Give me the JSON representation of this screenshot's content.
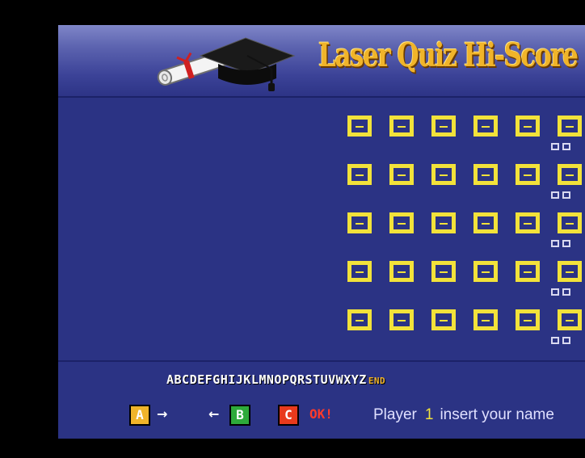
{
  "header": {
    "title": "Laser Quiz Hi-Score"
  },
  "name_grid": {
    "rows": 5,
    "visible_slots_per_row": 6,
    "slot_color": "#f2e23a",
    "background_color": "#2b3384"
  },
  "alphabet": {
    "letters": "ABCDEFGHIJKLMNOPQRSTUVWXYZ",
    "end_label": "END"
  },
  "controls": {
    "a_label": "A",
    "a_arrow": "→",
    "b_arrow": "←",
    "b_label": "B",
    "c_label": "C",
    "ok_label": "OK!"
  },
  "status": {
    "prefix": "Player",
    "player_number": "1",
    "suffix": "insert your name"
  },
  "colors": {
    "title": "#f0b42a",
    "key_a": "#f0b42a",
    "key_b": "#2eaa3a",
    "key_c": "#e83a1c",
    "ok_text": "#ff3a2a"
  }
}
